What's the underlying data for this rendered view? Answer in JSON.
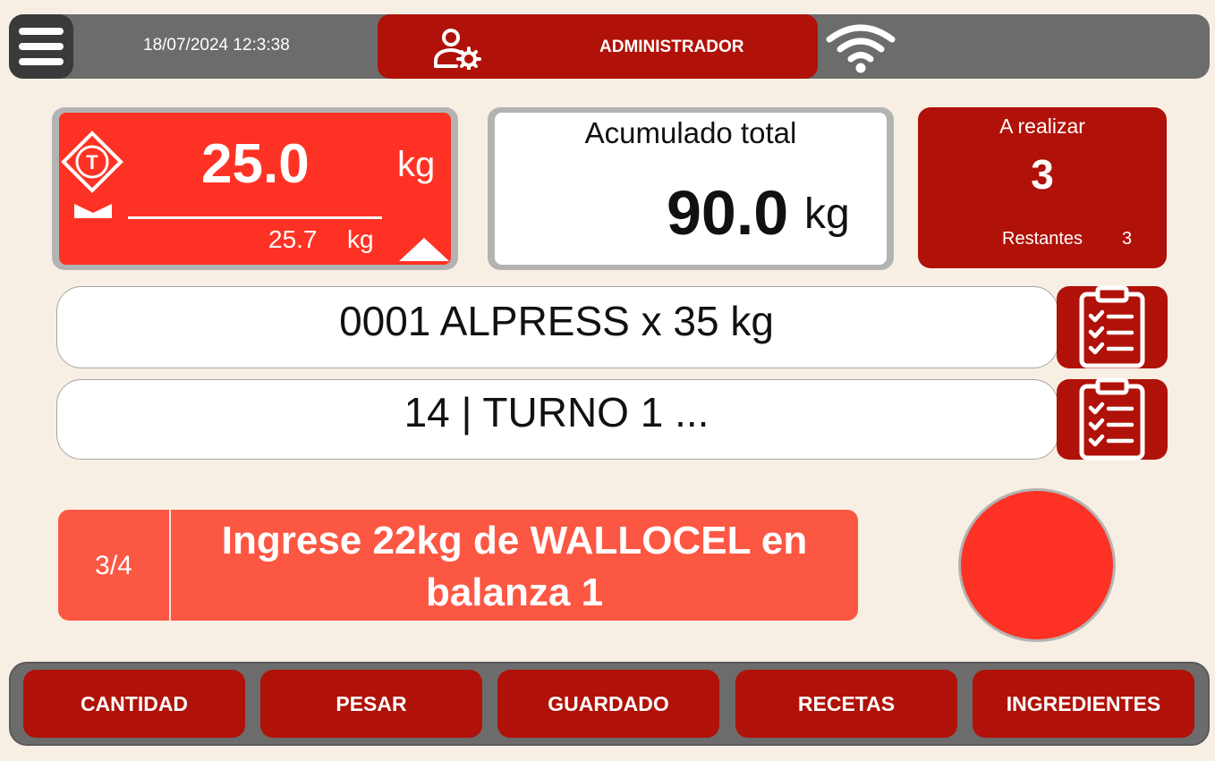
{
  "header": {
    "datetime": "18/07/2024 12:3:38",
    "user_role": "ADMINISTRADOR",
    "icons": [
      "menu-icon",
      "user-settings-icon",
      "wifi-icon"
    ]
  },
  "scale": {
    "tare_symbol": "T",
    "net_weight": "25.0",
    "net_unit": "kg",
    "gross_weight": "25.7",
    "gross_unit": "kg",
    "icons": [
      "tare-icon",
      "zero-icon",
      "stable-icon"
    ]
  },
  "accumulated": {
    "title": "Acumulado total",
    "value": "90.0",
    "unit": "kg"
  },
  "to_do": {
    "title": "A realizar",
    "value": "3",
    "remaining_label": "Restantes",
    "remaining_value": "3"
  },
  "recipe": {
    "text": "0001 ALPRESS x 35 kg"
  },
  "shift": {
    "text": "14 | TURNO 1 ..."
  },
  "instruction": {
    "step": "3/4",
    "text": "Ingrese 22kg de WALLOCEL en balanza 1"
  },
  "bottom_nav": {
    "cantidad": "CANTIDAD",
    "pesar": "PESAR",
    "guardado": "GUARDADO",
    "recetas": "RECETAS",
    "ingredientes": "INGREDIENTES"
  },
  "colors": {
    "background": "#f8efe4",
    "bar_gray": "#6c6c6c",
    "dark_red": "#b01108",
    "bright_red": "#fe3224",
    "instruction_red": "#fc5743"
  }
}
